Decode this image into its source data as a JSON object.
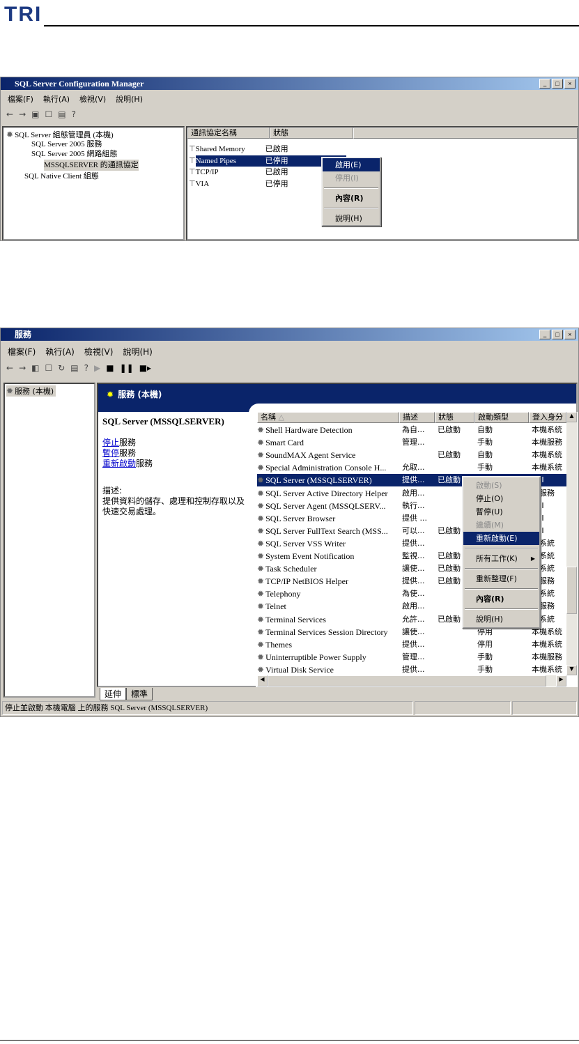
{
  "doc": {
    "logo": "TRI"
  },
  "win1": {
    "title": "SQL Server Configuration Manager",
    "menu": [
      "檔案(F)",
      "執行(A)",
      "檢視(V)",
      "說明(H)"
    ],
    "tree": [
      "SQL Server 組態管理員 (本機)",
      "SQL Server 2005 服務",
      "SQL Server 2005 網路組態",
      "MSSQLSERVER 的通訊協定",
      "SQL Native Client 組態"
    ],
    "columns": [
      "通訊協定名稱",
      "狀態"
    ],
    "rows": [
      {
        "name": "Shared Memory",
        "status": "已啟用"
      },
      {
        "name": "Named Pipes",
        "status": "已停用"
      },
      {
        "name": "TCP/IP",
        "status": "已啟用"
      },
      {
        "name": "VIA",
        "status": "已停用"
      }
    ],
    "context_menu": [
      "啟用(E)",
      "停用(I)",
      "內容(R)",
      "說明(H)"
    ]
  },
  "win2": {
    "title": "服務",
    "menu": [
      "檔案(F)",
      "執行(A)",
      "檢視(V)",
      "說明(H)"
    ],
    "tree_item": "服務 (本機)",
    "header": "服務 (本機)",
    "detail": {
      "service_name": "SQL Server (MSSQLSERVER)",
      "stop_link": "停止",
      "pause_link": "暫停",
      "restart_link": "重新啟動",
      "suffix": "服務",
      "desc_label": "描述:",
      "desc": "提供資料的儲存、處理和控制存取以及快速交易處理。"
    },
    "columns": [
      "名稱",
      "描述",
      "狀態",
      "啟動類型",
      "登入身分"
    ],
    "rows": [
      [
        "Shell Hardware Detection",
        "為自...",
        "已啟動",
        "自動",
        "本機系統"
      ],
      [
        "Smart Card",
        "管理...",
        "",
        "手動",
        "本機服務"
      ],
      [
        "SoundMAX Agent Service",
        "",
        "已啟動",
        "自動",
        "本機系統"
      ],
      [
        "Special Administration Console H...",
        "允取...",
        "",
        "手動",
        "本機系統"
      ],
      [
        "SQL Server (MSSQLSERVER)",
        "提供...",
        "已啟動",
        "",
        "TRI"
      ],
      [
        "SQL Server Active Directory Helper",
        "啟用...",
        "",
        "",
        "路服務"
      ],
      [
        "SQL Server Agent (MSSQLSERV...",
        "執行...",
        "",
        "",
        "TRI"
      ],
      [
        "SQL Server Browser",
        "提供 ...",
        "",
        "",
        "TRI"
      ],
      [
        "SQL Server FullText Search (MSS...",
        "可以...",
        "已啟動",
        "",
        "TRI"
      ],
      [
        "SQL Server VSS Writer",
        "提供...",
        "",
        "",
        "機系統"
      ],
      [
        "System Event Notification",
        "監視...",
        "已啟動",
        "",
        "機系統"
      ],
      [
        "Task Scheduler",
        "讓使...",
        "已啟動",
        "",
        "機系統"
      ],
      [
        "TCP/IP NetBIOS Helper",
        "提供...",
        "已啟動",
        "",
        "機服務"
      ],
      [
        "Telephony",
        "為使...",
        "",
        "",
        "機系統"
      ],
      [
        "Telnet",
        "啟用...",
        "",
        "",
        "機服務"
      ],
      [
        "Terminal Services",
        "允許...",
        "已啟動",
        "",
        "機系統"
      ],
      [
        "Terminal Services Session Directory",
        "讓使...",
        "",
        "停用",
        "本機系統"
      ],
      [
        "Themes",
        "提供...",
        "",
        "停用",
        "本機系統"
      ],
      [
        "Uninterruptible Power Supply",
        "管理...",
        "",
        "手動",
        "本機服務"
      ],
      [
        "Virtual Disk Service",
        "提供...",
        "",
        "手動",
        "本機系統"
      ]
    ],
    "selected_row": 4,
    "context_menu": [
      {
        "label": "啟動(S)",
        "state": "disabled"
      },
      {
        "label": "停止(O)"
      },
      {
        "label": "暫停(U)"
      },
      {
        "label": "繼續(M)",
        "state": "disabled"
      },
      {
        "label": "重新啟動(E)",
        "state": "highlighted"
      },
      {
        "label": "所有工作(K)",
        "submenu": true
      },
      {
        "label": "重新整理(F)"
      },
      {
        "label": "內容(R)",
        "bold": true
      },
      {
        "label": "說明(H)"
      }
    ],
    "tabs": [
      "延伸",
      "標準"
    ],
    "status": "停止並啟動 本機電腦 上的服務 SQL Server (MSSQLSERVER)"
  }
}
